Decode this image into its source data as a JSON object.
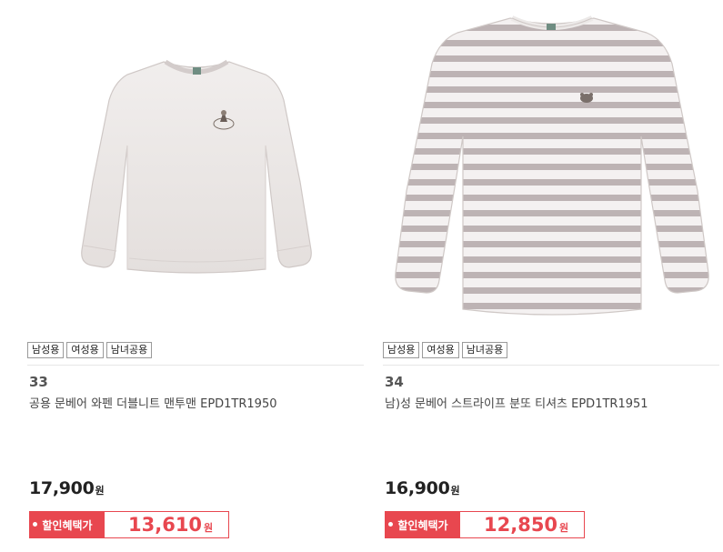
{
  "products": [
    {
      "number": "33",
      "title": "공용 문베어 와펜 더블니트 맨투맨 EPD1TR1950",
      "tags": [
        "남성용",
        "여성용",
        "남녀공용"
      ],
      "price": "17,900",
      "price_unit": "원",
      "sale_label": "할인혜택가",
      "sale_price": "13,610",
      "sale_unit": "원",
      "image": "plain-sweatshirt"
    },
    {
      "number": "34",
      "title": "남)성 문베어 스트라이프 분또 티셔츠 EPD1TR1951",
      "tags": [
        "남성용",
        "여성용",
        "남녀공용"
      ],
      "price": "16,900",
      "price_unit": "원",
      "sale_label": "할인혜택가",
      "sale_price": "12,850",
      "sale_unit": "원",
      "image": "striped-tshirt"
    }
  ],
  "colors": {
    "accent": "#e8474f",
    "garment": "#ece8e6",
    "stripe": "#bdb3b4"
  }
}
